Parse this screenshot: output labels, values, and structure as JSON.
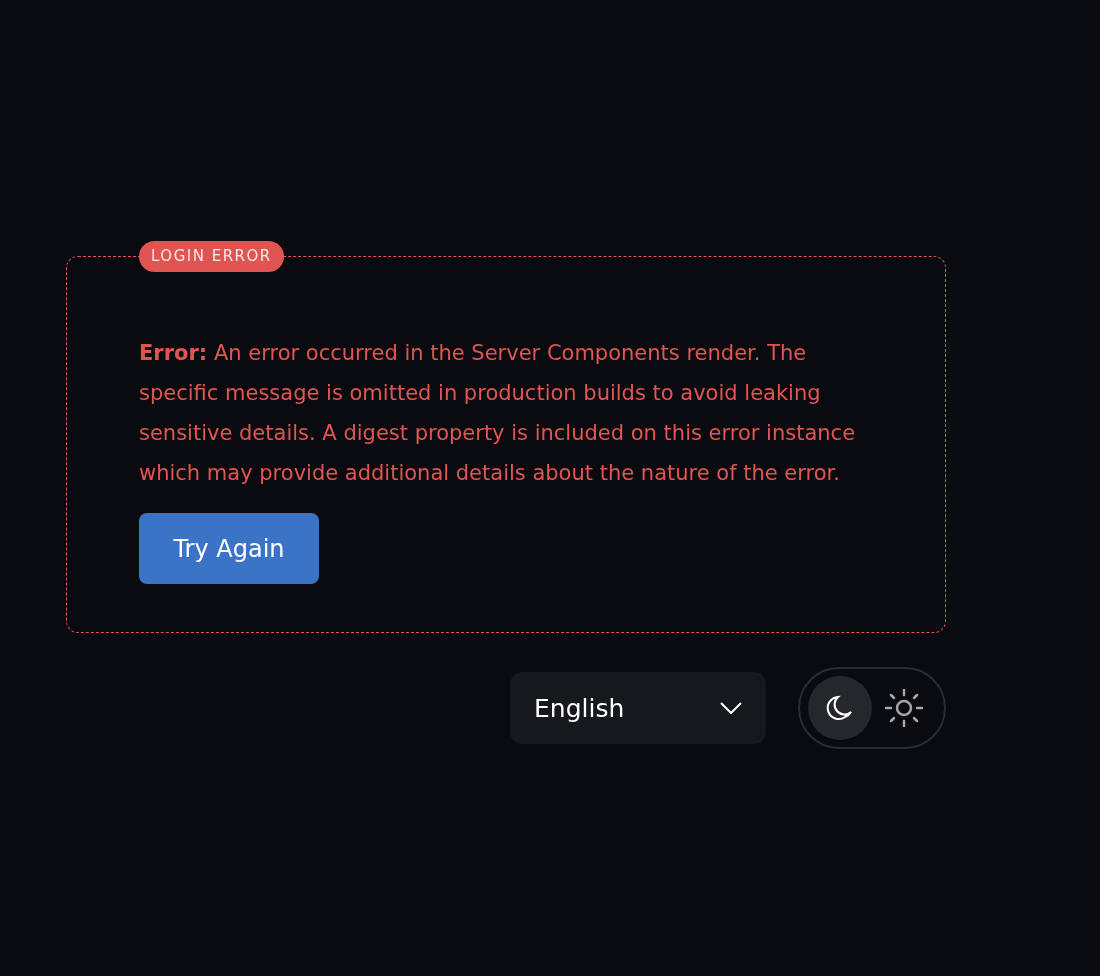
{
  "error_card": {
    "badge": "LOGIN ERROR",
    "message": "**Error:** An error occurred in the Server Components render. The specific message is omitted in production builds to avoid leaking sensitive details. A digest property is included on this error instance which may provide additional details about the nature of the error.",
    "button": "Try Again"
  },
  "language_select": {
    "value": "English"
  },
  "theme_toggle": [
    {
      "kind": "dark",
      "selected": true
    },
    {
      "kind": "light",
      "selected": false
    }
  ]
}
